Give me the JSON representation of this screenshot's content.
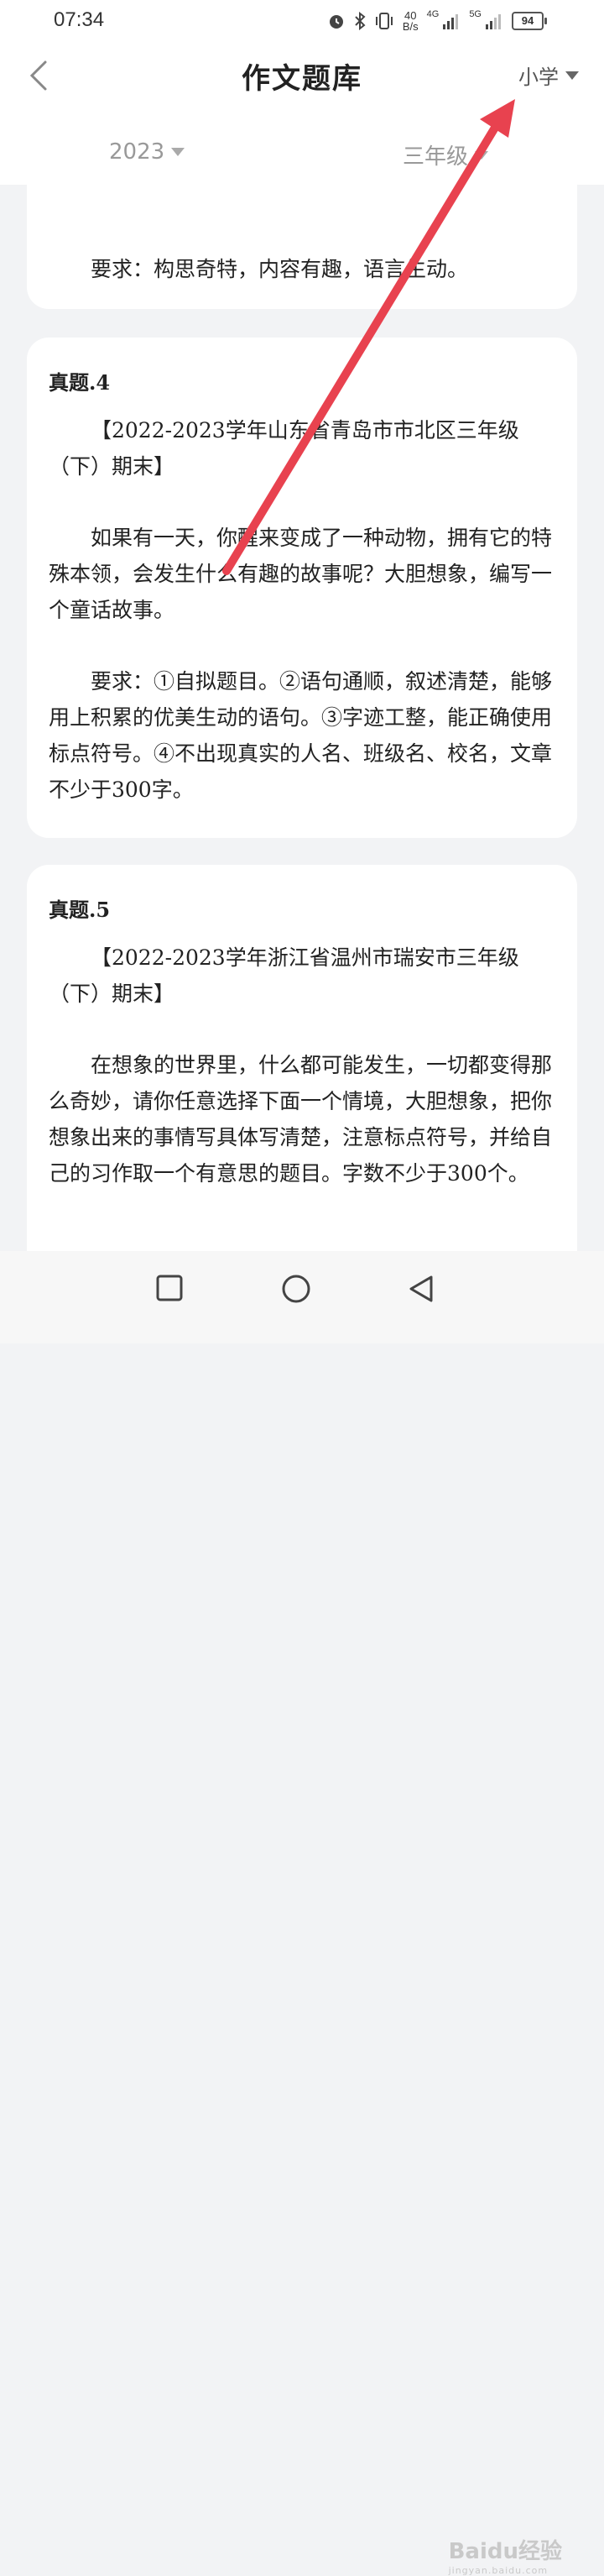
{
  "status": {
    "time": "07:34",
    "speed_value": "40",
    "speed_unit": "B/s",
    "net1": "4G",
    "net2": "5G",
    "battery": "94"
  },
  "header": {
    "title": "作文题库",
    "level": "小学"
  },
  "filters": {
    "year": "2023",
    "grade": "三年级"
  },
  "cards": [
    {
      "requirement": "要求：构思奇特，内容有趣，语言生动。"
    },
    {
      "title": "真题.4",
      "source": "【2022-2023学年山东省青岛市市北区三年级（下）期末】",
      "prompt": "如果有一天，你醒来变成了一种动物，拥有它的特殊本领，会发生什么有趣的故事呢？大胆想象，编写一个童话故事。",
      "requirement": "要求：①自拟题目。②语句通顺，叙述清楚，能够用上积累的优美生动的语句。③字迹工整，能正确使用标点符号。④不出现真实的人名、班级名、校名，文章不少于300字。"
    },
    {
      "title": "真题.5",
      "source": "【2022-2023学年浙江省温州市瑞安市三年级（下）期末】",
      "prompt": "在想象的世界里，什么都可能发生，一切都变得那么奇妙，请你任意选择下面一个情境，大胆想象，把你想象出来的事情写具体写清楚，注意标点符号，并给自己的习作取一个有意思的题目。字数不少于300个。"
    }
  ],
  "watermark": {
    "brand": "Baidu经验",
    "url": "jingyan.baidu.com"
  },
  "colors": {
    "arrow": "#e8424f",
    "background": "#f2f3f5",
    "card": "#ffffff"
  }
}
